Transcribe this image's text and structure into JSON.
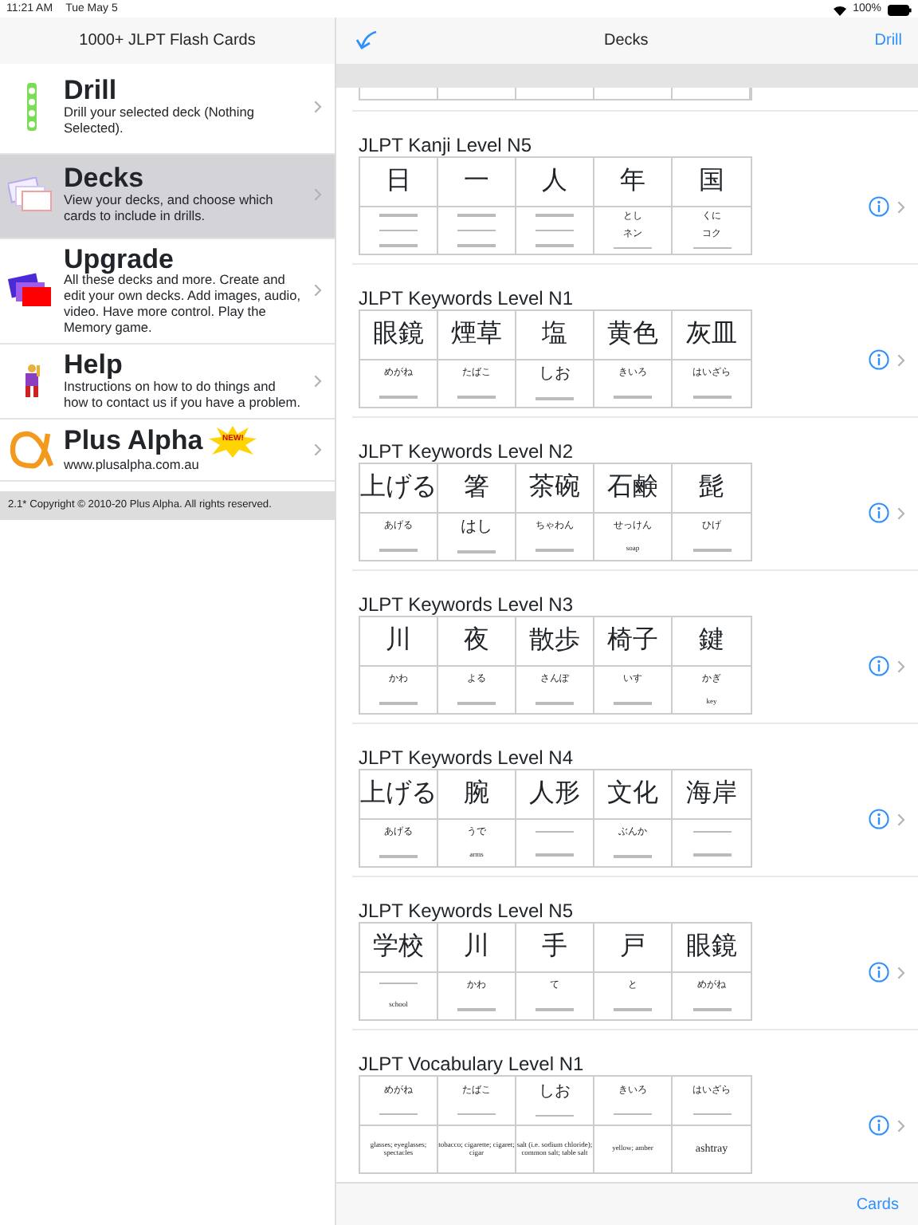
{
  "status_bar": {
    "time": "11:21 AM",
    "date": "Tue May 5",
    "battery": "100%"
  },
  "sidebar": {
    "title": "1000+ JLPT Flash Cards",
    "items": [
      {
        "kind": "drill",
        "title": "Drill",
        "description": "Drill your selected deck (Nothing Selected).",
        "selected": false
      },
      {
        "kind": "decks",
        "title": "Decks",
        "description": "View your decks, and choose which cards to include in drills.",
        "selected": true
      },
      {
        "kind": "upgrade",
        "title": "Upgrade",
        "description": "All these decks and more. Create and edit your own decks. Add images, audio, video. Have more control. Play the Memory game.",
        "selected": false
      },
      {
        "kind": "help",
        "title": "Help",
        "description": "Instructions on how to do things and how to contact us if you have a problem.",
        "selected": false
      },
      {
        "kind": "alpha",
        "title": "Plus Alpha",
        "description": "www.plusalpha.com.au",
        "badge": "NEW!",
        "selected": false
      }
    ],
    "footer": "2.1* Copyright © 2010-20 Plus Alpha. All rights reserved."
  },
  "nav": {
    "title": "Decks",
    "right_button": "Drill"
  },
  "decks": [
    {
      "title": "JLPT Kanji Level N5",
      "cards": [
        {
          "top": [
            {
              "kind": "big",
              "text": "日"
            }
          ],
          "bottom": [
            {
              "kind": "blurred"
            },
            {
              "kind": "blurred"
            },
            {
              "kind": "blurred"
            }
          ]
        },
        {
          "top": [
            {
              "kind": "big",
              "text": "一"
            }
          ],
          "bottom": [
            {
              "kind": "blurred"
            },
            {
              "kind": "blurred"
            },
            {
              "kind": "blurred"
            }
          ]
        },
        {
          "top": [
            {
              "kind": "big",
              "text": "人"
            }
          ],
          "bottom": [
            {
              "kind": "blurred"
            },
            {
              "kind": "blurred"
            },
            {
              "kind": "blurred"
            }
          ]
        },
        {
          "top": [
            {
              "kind": "big",
              "text": "年"
            }
          ],
          "bottom": [
            {
              "kind": "tiny",
              "text": "とし"
            },
            {
              "kind": "tiny",
              "text": "ネン"
            },
            {
              "kind": "blurred"
            }
          ]
        },
        {
          "top": [
            {
              "kind": "big",
              "text": "国"
            }
          ],
          "bottom": [
            {
              "kind": "tiny",
              "text": "くに"
            },
            {
              "kind": "tiny",
              "text": "コク"
            },
            {
              "kind": "blurred"
            }
          ]
        }
      ]
    },
    {
      "title": "JLPT Keywords Level N1",
      "cards": [
        {
          "top": [
            {
              "kind": "big",
              "text": "眼鏡"
            }
          ],
          "bottom": [
            {
              "kind": "tiny",
              "text": "めがね"
            },
            {
              "kind": "blurred"
            }
          ]
        },
        {
          "top": [
            {
              "kind": "big",
              "text": "煙草"
            }
          ],
          "bottom": [
            {
              "kind": "tiny",
              "text": "たばこ"
            },
            {
              "kind": "blurred"
            }
          ]
        },
        {
          "top": [
            {
              "kind": "big",
              "text": "塩"
            }
          ],
          "bottom": [
            {
              "kind": "small",
              "text": "しお"
            },
            {
              "kind": "blurred"
            }
          ]
        },
        {
          "top": [
            {
              "kind": "big",
              "text": "黄色"
            }
          ],
          "bottom": [
            {
              "kind": "tiny",
              "text": "きいろ"
            },
            {
              "kind": "blurred"
            }
          ]
        },
        {
          "top": [
            {
              "kind": "big",
              "text": "灰皿"
            }
          ],
          "bottom": [
            {
              "kind": "tiny",
              "text": "はいざら"
            },
            {
              "kind": "blurred"
            }
          ]
        }
      ]
    },
    {
      "title": "JLPT Keywords Level N2",
      "cards": [
        {
          "top": [
            {
              "kind": "big",
              "text": "上げる"
            }
          ],
          "bottom": [
            {
              "kind": "tiny",
              "text": "あげる"
            },
            {
              "kind": "blurred"
            }
          ]
        },
        {
          "top": [
            {
              "kind": "big",
              "text": "箸"
            }
          ],
          "bottom": [
            {
              "kind": "small",
              "text": "はし"
            },
            {
              "kind": "blurred"
            }
          ]
        },
        {
          "top": [
            {
              "kind": "big",
              "text": "茶碗"
            }
          ],
          "bottom": [
            {
              "kind": "tiny",
              "text": "ちゃわん"
            },
            {
              "kind": "blurred"
            }
          ]
        },
        {
          "top": [
            {
              "kind": "big",
              "text": "石鹸"
            }
          ],
          "bottom": [
            {
              "kind": "tiny",
              "text": "せっけん"
            },
            {
              "kind": "serif",
              "text": "soap"
            }
          ]
        },
        {
          "top": [
            {
              "kind": "big",
              "text": "髭"
            }
          ],
          "bottom": [
            {
              "kind": "tiny",
              "text": "ひげ"
            },
            {
              "kind": "blurred"
            }
          ]
        }
      ]
    },
    {
      "title": "JLPT Keywords Level N3",
      "cards": [
        {
          "top": [
            {
              "kind": "big",
              "text": "川"
            }
          ],
          "bottom": [
            {
              "kind": "tiny",
              "text": "かわ"
            },
            {
              "kind": "blurred"
            }
          ]
        },
        {
          "top": [
            {
              "kind": "big",
              "text": "夜"
            }
          ],
          "bottom": [
            {
              "kind": "tiny",
              "text": "よる"
            },
            {
              "kind": "blurred"
            }
          ]
        },
        {
          "top": [
            {
              "kind": "big",
              "text": "散歩"
            }
          ],
          "bottom": [
            {
              "kind": "tiny",
              "text": "さんぽ"
            },
            {
              "kind": "blurred"
            }
          ]
        },
        {
          "top": [
            {
              "kind": "big",
              "text": "椅子"
            }
          ],
          "bottom": [
            {
              "kind": "tiny",
              "text": "いす"
            },
            {
              "kind": "blurred"
            }
          ]
        },
        {
          "top": [
            {
              "kind": "big",
              "text": "鍵"
            }
          ],
          "bottom": [
            {
              "kind": "tiny",
              "text": "かぎ"
            },
            {
              "kind": "serif",
              "text": "key"
            }
          ]
        }
      ]
    },
    {
      "title": "JLPT Keywords Level N4",
      "cards": [
        {
          "top": [
            {
              "kind": "big",
              "text": "上げる"
            }
          ],
          "bottom": [
            {
              "kind": "tiny",
              "text": "あげる"
            },
            {
              "kind": "blurred"
            }
          ]
        },
        {
          "top": [
            {
              "kind": "big",
              "text": "腕"
            }
          ],
          "bottom": [
            {
              "kind": "tiny",
              "text": "うで"
            },
            {
              "kind": "serif",
              "text": "arms"
            }
          ]
        },
        {
          "top": [
            {
              "kind": "big",
              "text": "人形"
            }
          ],
          "bottom": [
            {
              "kind": "blurred"
            },
            {
              "kind": "blurred"
            }
          ]
        },
        {
          "top": [
            {
              "kind": "big",
              "text": "文化"
            }
          ],
          "bottom": [
            {
              "kind": "tiny",
              "text": "ぶんか"
            },
            {
              "kind": "blurred"
            }
          ]
        },
        {
          "top": [
            {
              "kind": "big",
              "text": "海岸"
            }
          ],
          "bottom": [
            {
              "kind": "blurred"
            },
            {
              "kind": "blurred"
            }
          ]
        }
      ]
    },
    {
      "title": "JLPT Keywords Level N5",
      "cards": [
        {
          "top": [
            {
              "kind": "big",
              "text": "学校"
            }
          ],
          "bottom": [
            {
              "kind": "blurred"
            },
            {
              "kind": "serif",
              "text": "school"
            }
          ]
        },
        {
          "top": [
            {
              "kind": "big",
              "text": "川"
            }
          ],
          "bottom": [
            {
              "kind": "tiny",
              "text": "かわ"
            },
            {
              "kind": "blurred"
            }
          ]
        },
        {
          "top": [
            {
              "kind": "big",
              "text": "手"
            }
          ],
          "bottom": [
            {
              "kind": "tiny",
              "text": "て"
            },
            {
              "kind": "blurred"
            }
          ]
        },
        {
          "top": [
            {
              "kind": "big",
              "text": "戸"
            }
          ],
          "bottom": [
            {
              "kind": "tiny",
              "text": "と"
            },
            {
              "kind": "blurred"
            }
          ]
        },
        {
          "top": [
            {
              "kind": "big",
              "text": "眼鏡"
            }
          ],
          "bottom": [
            {
              "kind": "tiny",
              "text": "めがね"
            },
            {
              "kind": "blurred"
            }
          ]
        }
      ]
    },
    {
      "title": "JLPT Vocabulary Level N1",
      "cards": [
        {
          "top": [
            {
              "kind": "tiny",
              "text": "めがね"
            },
            {
              "kind": "blurred"
            }
          ],
          "bottom": [
            {
              "kind": "serif",
              "text": "glasses; eyeglasses; spectacles"
            }
          ]
        },
        {
          "top": [
            {
              "kind": "tiny",
              "text": "たばこ"
            },
            {
              "kind": "blurred"
            }
          ],
          "bottom": [
            {
              "kind": "serif",
              "text": "tobacco; cigarette; cigaret; cigar"
            }
          ]
        },
        {
          "top": [
            {
              "kind": "small",
              "text": "しお"
            },
            {
              "kind": "blurred"
            }
          ],
          "bottom": [
            {
              "kind": "serif",
              "text": "salt (i.e. sodium chloride); common salt; table salt"
            }
          ]
        },
        {
          "top": [
            {
              "kind": "tiny",
              "text": "きいろ"
            },
            {
              "kind": "blurred"
            }
          ],
          "bottom": [
            {
              "kind": "serif",
              "text": "yellow; amber"
            }
          ]
        },
        {
          "top": [
            {
              "kind": "tiny",
              "text": "はいざら"
            },
            {
              "kind": "blurred"
            }
          ],
          "bottom": [
            {
              "kind": "serifbig",
              "text": "ashtray"
            }
          ]
        }
      ]
    }
  ],
  "toolbar": {
    "button": "Cards"
  }
}
